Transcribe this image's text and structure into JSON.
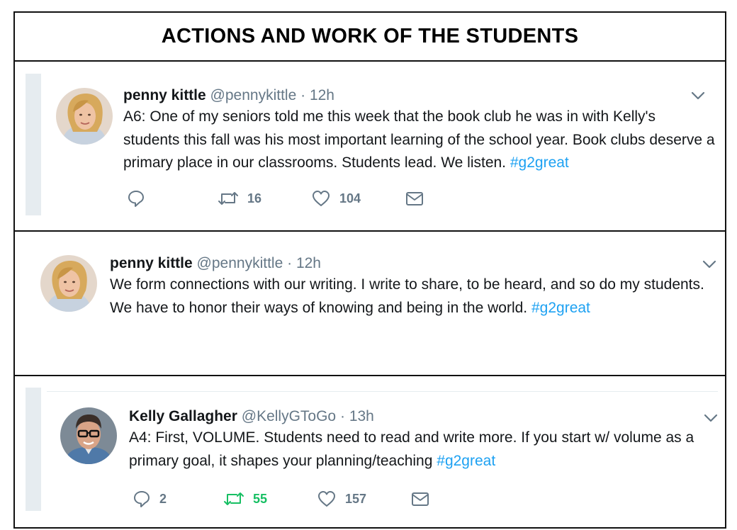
{
  "header": {
    "title": "ACTIONS AND WORK OF THE STUDENTS"
  },
  "colors": {
    "link": "#1da1f2",
    "muted": "#657786",
    "retweet_active": "#17bf63",
    "thread_bar": "#e6ecf0"
  },
  "tweets": [
    {
      "author_name": "penny kittle",
      "handle": "@pennykittle",
      "separator": "·",
      "time": "12h",
      "text": "A6: One of my seniors told me this week that the book club he was in with Kelly's students this fall was his most important learning of the school year. Book clubs deserve a primary place in our classrooms. Students lead. We listen.",
      "hashtag": "#g2great",
      "avatar_icon": "avatar-woman-blonde",
      "actions": {
        "reply_count": "",
        "retweet_count": "16",
        "like_count": "104"
      }
    },
    {
      "author_name": "penny kittle",
      "handle": "@pennykittle",
      "separator": "·",
      "time": "12h",
      "text": "We form connections with our writing. I write to share, to be heard, and so do my students. We have to honor their ways of knowing and being in the world.",
      "hashtag": "#g2great",
      "avatar_icon": "avatar-woman-blonde"
    },
    {
      "author_name": "Kelly Gallagher",
      "handle": "@KellyGToGo",
      "separator": "·",
      "time": "13h",
      "text": "A4: First, VOLUME. Students need to read and write more. If you start w/ volume as a primary goal, it shapes your planning/teaching",
      "hashtag": "#g2great",
      "avatar_icon": "avatar-man-glasses",
      "actions": {
        "reply_count": "2",
        "retweet_count": "55",
        "like_count": "157",
        "retweet_active": true
      }
    }
  ]
}
